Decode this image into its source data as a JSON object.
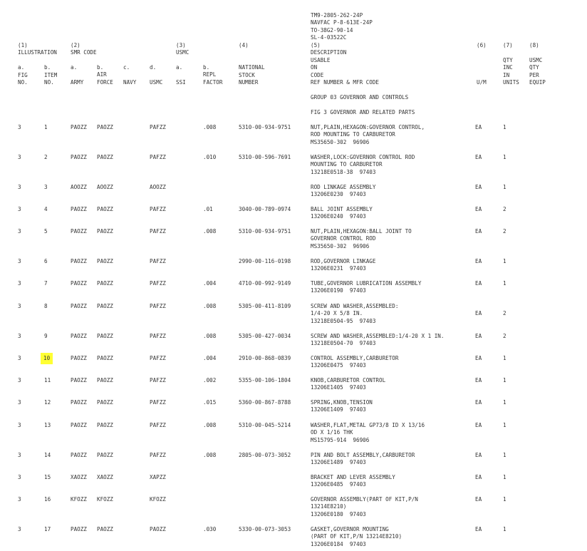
{
  "doc_ids": [
    "TM9-2805-262-24P",
    "NAVFAC P-8-613E-24P",
    "TO-38G2-90-14",
    "SL-4-03522C"
  ],
  "headers": {
    "col1": [
      "(1)",
      "ILLUSTRATION",
      "",
      "a.",
      "FIG",
      "NO."
    ],
    "col1b": [
      "",
      "",
      "",
      "b.",
      "ITEM",
      "NO."
    ],
    "col2": [
      "(2)",
      "SMR CODE"
    ],
    "col2a": [
      "a.",
      "",
      "ARMY"
    ],
    "col2b": [
      "b.",
      "AIR",
      "FORCE"
    ],
    "col2c": [
      "c.",
      "",
      "NAVY"
    ],
    "col2d": [
      "d.",
      "",
      "USMC"
    ],
    "col3": [
      "(3)",
      "USMC"
    ],
    "col3a": [
      "a.",
      "",
      "SSI"
    ],
    "col3b": [
      "b.",
      "REPL",
      "FACTOR"
    ],
    "col4": [
      "(4)",
      "",
      "",
      "NATIONAL",
      "STOCK",
      "NUMBER"
    ],
    "col5": [
      "(5)",
      "DESCRIPTION",
      "USABLE",
      "ON",
      "CODE",
      "REF NUMBER & MFR CODE"
    ],
    "col6": [
      "(6)",
      "",
      "",
      "",
      "",
      "U/M"
    ],
    "col7": [
      "(7)",
      "",
      "QTY",
      "INC",
      "IN",
      "UNITS"
    ],
    "col8": [
      "(8)",
      "",
      "USMC",
      "QTY",
      "PER",
      "EQUIP"
    ]
  },
  "group_title": "GROUP 03 GOVERNOR AND CONTROLS",
  "fig_title": "FIG 3 GOVERNOR AND RELATED PARTS",
  "rows": [
    {
      "fig": "3",
      "item": "1",
      "army": "PAOZZ",
      "af": "PAOZZ",
      "navy": "",
      "usmc": "PAFZZ",
      "ssi": "",
      "repl": ".008",
      "nsn": "5310-00-934-9751",
      "desc": [
        "NUT,PLAIN,HEXAGON:GOVERNOR CONTROL,",
        "ROD MOUNTING TO CARBURETOR",
        "MS35650-302  96906"
      ],
      "um": "EA",
      "qty": "1"
    },
    {
      "fig": "3",
      "item": "2",
      "army": "PAOZZ",
      "af": "PAOZZ",
      "navy": "",
      "usmc": "PAFZZ",
      "ssi": "",
      "repl": ".010",
      "nsn": "5310-00-596-7691",
      "desc": [
        "WASHER,LOCK:GOVERNOR CONTROL ROD",
        "MOUNTING TO CARBURETOR",
        "13218E0518-38  97403"
      ],
      "um": "EA",
      "qty": "1"
    },
    {
      "fig": "3",
      "item": "3",
      "army": "AOOZZ",
      "af": "AOOZZ",
      "navy": "",
      "usmc": "AOOZZ",
      "ssi": "",
      "repl": "",
      "nsn": "",
      "desc": [
        "ROD LINKAGE ASSEMBLY",
        "13206E0230  97403"
      ],
      "um": "EA",
      "qty": "1"
    },
    {
      "fig": "3",
      "item": "4",
      "army": "PAOZZ",
      "af": "PAOZZ",
      "navy": "",
      "usmc": "PAFZZ",
      "ssi": "",
      "repl": ".01",
      "nsn": "3040-00-789-0974",
      "desc": [
        "BALL JOINT ASSEMBLY",
        "13206E0240  97403"
      ],
      "um": "EA",
      "qty": "2"
    },
    {
      "fig": "3",
      "item": "5",
      "army": "PAOZZ",
      "af": "PAOZZ",
      "navy": "",
      "usmc": "PAFZZ",
      "ssi": "",
      "repl": ".008",
      "nsn": "5310-00-934-9751",
      "desc": [
        "NUT,PLAIN,HEXAGON:BALL JOINT TO",
        "GOVERNOR CONTROL ROD",
        "MS35650-302  96906"
      ],
      "um": "EA",
      "qty": "2"
    },
    {
      "fig": "3",
      "item": "6",
      "army": "PAOZZ",
      "af": "PAOZZ",
      "navy": "",
      "usmc": "PAFZZ",
      "ssi": "",
      "repl": "",
      "nsn": "2990-00-116-0198",
      "desc": [
        "ROD,GOVERNOR LINKAGE",
        "13206E0231  97403"
      ],
      "um": "EA",
      "qty": "1"
    },
    {
      "fig": "3",
      "item": "7",
      "army": "PAOZZ",
      "af": "PAOZZ",
      "navy": "",
      "usmc": "PAFZZ",
      "ssi": "",
      "repl": ".004",
      "nsn": "4710-00-992-9149",
      "desc": [
        "TUBE,GOVERNOR LUBRICATION ASSEMBLY",
        "13206E0190  97403"
      ],
      "um": "EA",
      "qty": "1"
    },
    {
      "fig": "3",
      "item": "8",
      "army": "PAOZZ",
      "af": "PAOZZ",
      "navy": "",
      "usmc": "PAFZZ",
      "ssi": "",
      "repl": ".008",
      "nsn": "5305-00-411-8109",
      "desc": [
        "SCREW AND WASHER,ASSEMBLED:",
        "1/4-20 X 5/8 IN.",
        "13218E0504-95  97403"
      ],
      "um": "EA",
      "qty": "2",
      "um_line": 1
    },
    {
      "fig": "3",
      "item": "9",
      "army": "PAOZZ",
      "af": "PAOZZ",
      "navy": "",
      "usmc": "PAFZZ",
      "ssi": "",
      "repl": ".008",
      "nsn": "5305-00-427-0034",
      "desc": [
        "SCREW AND WASHER,ASSEMBLED:1/4-20 X 1 IN.",
        "13218E0504-70  97403"
      ],
      "um": "EA",
      "qty": "2"
    },
    {
      "fig": "3",
      "item": "10",
      "army": "PAOZZ",
      "af": "PAOZZ",
      "navy": "",
      "usmc": "PAFZZ",
      "ssi": "",
      "repl": ".004",
      "nsn": "2910-00-868-0839",
      "desc": [
        "CONTROL ASSEMBLY,CARBURETOR",
        "13206E0475  97403"
      ],
      "um": "EA",
      "qty": "1",
      "highlight": true
    },
    {
      "fig": "3",
      "item": "11",
      "army": "PAOZZ",
      "af": "PAOZZ",
      "navy": "",
      "usmc": "PAFZZ",
      "ssi": "",
      "repl": ".002",
      "nsn": "5355-00-106-1804",
      "desc": [
        "KNOB,CARBURETOR CONTROL",
        "13206E1405  97403"
      ],
      "um": "EA",
      "qty": "1"
    },
    {
      "fig": "3",
      "item": "12",
      "army": "PAOZZ",
      "af": "PAOZZ",
      "navy": "",
      "usmc": "PAFZZ",
      "ssi": "",
      "repl": ".015",
      "nsn": "5360-00-867-8788",
      "desc": [
        "SPRING,KNOB,TENSION",
        "13206E1409  97403"
      ],
      "um": "EA",
      "qty": "1"
    },
    {
      "fig": "3",
      "item": "13",
      "army": "PAOZZ",
      "af": "PAOZZ",
      "navy": "",
      "usmc": "PAFZZ",
      "ssi": "",
      "repl": ".008",
      "nsn": "5310-00-045-5214",
      "desc": [
        "WASHER,FLAT,METAL GP73/8 ID X 13/16",
        "OD X 1/16 THK",
        "MS15795-914  96906"
      ],
      "um": "EA",
      "qty": "1"
    },
    {
      "fig": "3",
      "item": "14",
      "army": "PAOZZ",
      "af": "PAOZZ",
      "navy": "",
      "usmc": "PAFZZ",
      "ssi": "",
      "repl": ".008",
      "nsn": "2805-00-073-3052",
      "desc": [
        "PIN AND BOLT ASSEMBLY,CARBURETOR",
        "13206E1489  97403"
      ],
      "um": "EA",
      "qty": "1"
    },
    {
      "fig": "3",
      "item": "15",
      "army": "XAOZZ",
      "af": "XAOZZ",
      "navy": "",
      "usmc": "XAPZZ",
      "ssi": "",
      "repl": "",
      "nsn": "",
      "desc": [
        "BRACKET AND LEVER ASSEMBLY",
        "13206E0485  97403"
      ],
      "um": "EA",
      "qty": "1"
    },
    {
      "fig": "3",
      "item": "16",
      "army": "KFOZZ",
      "af": "KFOZZ",
      "navy": "",
      "usmc": "KFOZZ",
      "ssi": "",
      "repl": "",
      "nsn": "",
      "desc": [
        "GOVERNOR ASSEMBLY(PART OF KIT,P/N",
        "13214E8210)",
        "13206E0180  97403"
      ],
      "um": "EA",
      "qty": "1"
    },
    {
      "fig": "3",
      "item": "17",
      "army": "PAOZZ",
      "af": "PAOZZ",
      "navy": "",
      "usmc": "PAOZZ",
      "ssi": "",
      "repl": ".030",
      "nsn": "5330-00-073-3053",
      "desc": [
        "GASKET,GOVERNOR MOUNTING",
        "(PART OF KIT,P/N 13214E8210)",
        "13206E0184  97403"
      ],
      "um": "EA",
      "qty": "1"
    }
  ]
}
